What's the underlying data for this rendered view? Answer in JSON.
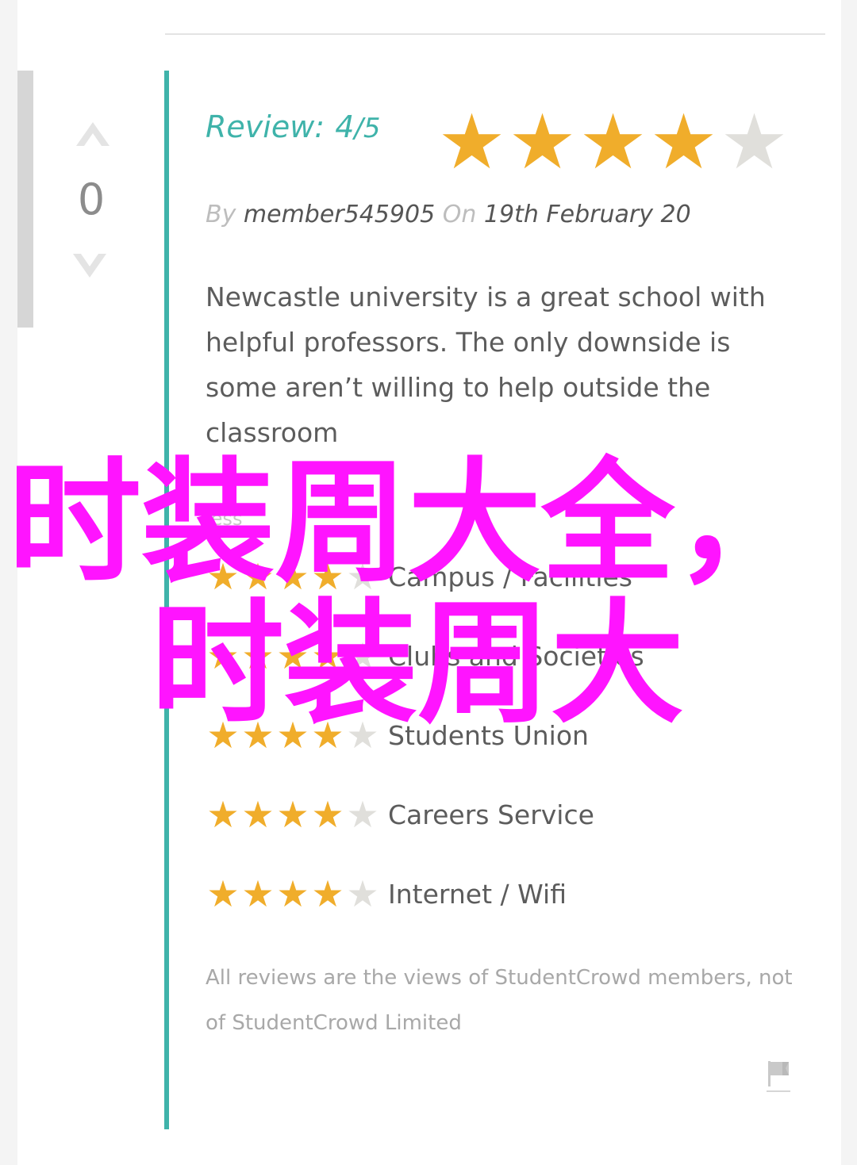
{
  "vote": {
    "count": "0"
  },
  "review": {
    "label": "Review:",
    "score": "4",
    "max": "/5",
    "rating": 4,
    "out_of": 5,
    "by_label": "By",
    "author": "member545905",
    "on_label": "On",
    "date": "19th February 20",
    "body": "Newcastle university is a great school with helpful professors. The only downside is some aren’t willing to help outside the classroom",
    "less_link": "less"
  },
  "categories": [
    {
      "label": "Campus / Facilities",
      "rating": 4
    },
    {
      "label": "Clubs and Societies",
      "rating": 4
    },
    {
      "label": "Students Union",
      "rating": 4
    },
    {
      "label": "Careers Service",
      "rating": 4
    },
    {
      "label": "Internet / Wifi",
      "rating": 4
    }
  ],
  "disclaimer": "All reviews are the views of StudentCrowd members, not of StudentCrowd Limited",
  "watermark": {
    "line1": "时装周大全，",
    "line2": "时装周大"
  },
  "colors": {
    "accent": "#3fb3aa",
    "star_on": "#f0ad2b",
    "star_off": "#e0dfdb",
    "watermark": "#ff14ff"
  },
  "icons": {
    "upvote": "chevron-up-icon",
    "downvote": "chevron-down-icon",
    "report": "flag-icon",
    "star": "star-icon"
  }
}
